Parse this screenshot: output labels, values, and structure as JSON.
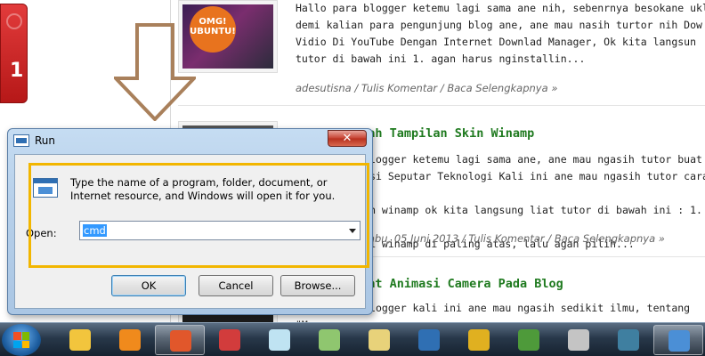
{
  "blog": {
    "thumb_badge": "OMG!\nUBUNTU!",
    "posts": [
      {
        "title": "",
        "excerpt": "  Hallo para blogger ketemu lagi sama ane nih, sebenrnya besokane ukl\ndemi kalian para pengunjung blog ane, ane mau nasih turtor nih Dow\nVidio Di YouTube Dengan Internet Downlad Manager, Ok kita langsun\ntutor di bawah ini  1. agan harus nginstallin...",
        "meta": "adesutisna / Tulis Komentar / Baca Selengkapnya »"
      },
      {
        "title": "Cara Merubah Tampilan Skin Winamp",
        "excerpt": "  Hallo para blogger ketemu lagi sama ane, ane mau ngasih tutor buat\nblog Informasi Seputar Teknologi  Kali ini ane mau ngasih tutor cara meng\nbuat tampilan winamp  ok kita langsung liat tutor di bawah ini : 1. ag\nbuka aplikasi winamp di paling atas, lalu agan pilih...",
        "meta": "adesutisna / Rabu, 05 Juni 2013 / Tulis Komentar / Baca Selengkapnya »"
      },
      {
        "title": "Cara Membuat Animasi Camera Pada Blog",
        "excerpt": "  Hallo para blogger kali ini ane mau ngasih sedikit ilmu, tentang \"Mem",
        "meta": ""
      }
    ]
  },
  "run_dialog": {
    "title": "Run",
    "close_label": "✕",
    "description": "Type the name of a program, folder, document, or Internet resource, and Windows will open it for you.",
    "open_label": "Open:",
    "open_value": "cmd",
    "buttons": {
      "ok": "OK",
      "cancel": "Cancel",
      "browse": "Browse..."
    }
  },
  "taskbar": {
    "items": [
      {
        "name": "windows-explorer",
        "color": "#f2c53d",
        "active": false
      },
      {
        "name": "vlc",
        "color": "#f08a1c",
        "active": false
      },
      {
        "name": "firefox",
        "color": "#e1572b",
        "active": true
      },
      {
        "name": "snipping-tool",
        "color": "#d23c3c",
        "active": false
      },
      {
        "name": "notepad",
        "color": "#bfe3f2",
        "active": false
      },
      {
        "name": "notepad-plus-plus",
        "color": "#8fc66f",
        "active": false
      },
      {
        "name": "paint",
        "color": "#e8d27a",
        "active": false
      },
      {
        "name": "photoshop",
        "color": "#2f6fb3",
        "active": false
      },
      {
        "name": "winamp",
        "color": "#e0b020",
        "active": false
      },
      {
        "name": "image-viewer",
        "color": "#4e9a3a",
        "active": false
      },
      {
        "name": "media-player",
        "color": "#c4c4c4",
        "active": false
      },
      {
        "name": "document-viewer",
        "color": "#3f7fa0",
        "active": false
      },
      {
        "name": "run-window",
        "color": "#4b8fd6",
        "active": true
      }
    ]
  },
  "colors": {
    "highlight_box": "#f2b600",
    "post_title": "#1f7a1f",
    "arrow": "#a9805b"
  }
}
